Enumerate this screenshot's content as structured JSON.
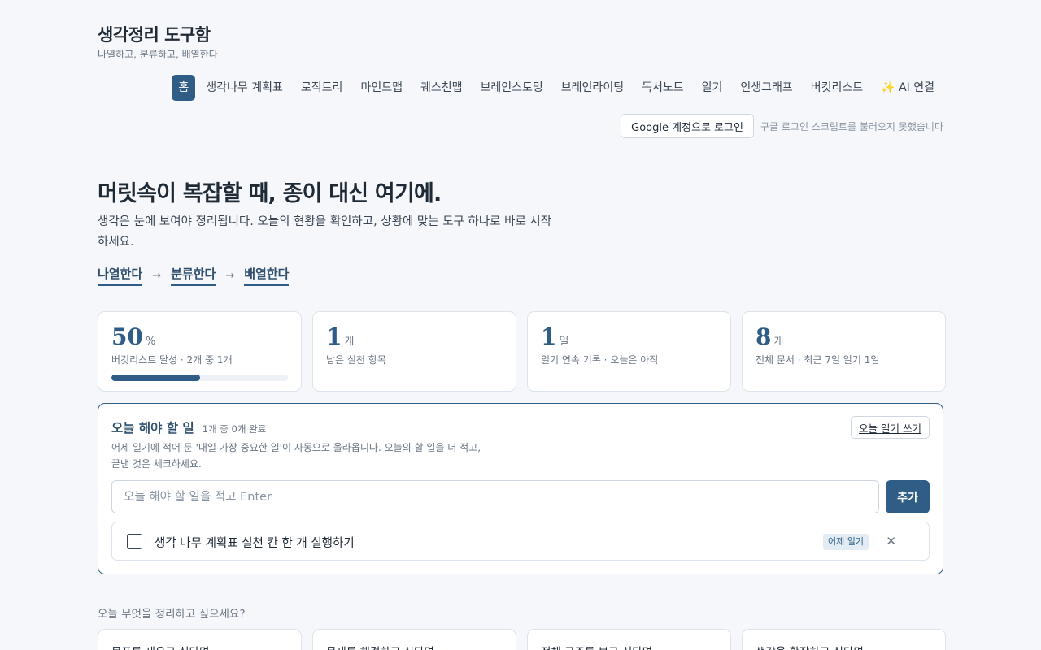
{
  "brand": {
    "title": "생각정리 도구함",
    "subtitle": "나열하고, 분류하고, 배열한다"
  },
  "nav": [
    {
      "label": "홈",
      "active": true
    },
    {
      "label": "생각나무 계획표"
    },
    {
      "label": "로직트리"
    },
    {
      "label": "마인드맵"
    },
    {
      "label": "퀘스천맵"
    },
    {
      "label": "브레인스토밍"
    },
    {
      "label": "브레인라이팅"
    },
    {
      "label": "독서노트"
    },
    {
      "label": "일기"
    },
    {
      "label": "인생그래프"
    },
    {
      "label": "버킷리스트"
    },
    {
      "label": "✨ AI 연결"
    }
  ],
  "login": {
    "button": "Google 계정으로 로그인",
    "note": "구글 로그인 스크립트를 불러오지 못했습니다"
  },
  "hero": {
    "title": "머릿속이 복잡할 때, 종이 대신 여기에.",
    "desc": "생각은 눈에 보여야 정리됩니다. 오늘의 현황을 확인하고, 상황에 맞는 도구 하나로 바로 시작하세요.",
    "steps": [
      "나열한다",
      "분류한다",
      "배열한다"
    ],
    "arrow": "→"
  },
  "stats": [
    {
      "value": "50",
      "unit": "%",
      "label": "버킷리스트 달성 · 2개 중 1개",
      "progress": 0.5
    },
    {
      "value": "1",
      "unit": "개",
      "label": "남은 실천 항목"
    },
    {
      "value": "1",
      "unit": "일",
      "label": "일기 연속 기록 · 오늘은 아직"
    },
    {
      "value": "8",
      "unit": "개",
      "label": "전체 문서 · 최근 7일 일기 1일"
    }
  ],
  "today": {
    "title": "오늘 해야 할 일",
    "count": "1개 중 0개 완료",
    "desc": "어제 일기에 적어 둔 '내일 가장 중요한 일'이 자동으로 올라옵니다. 오늘의 할 일을 더 적고, 끝낸 것은 체크하세요.",
    "diary_button": "오늘 일기 쓰기",
    "input_placeholder": "오늘 해야 할 일을 적고 Enter",
    "add_button": "추가",
    "items": [
      {
        "text": "생각 나무 계획표 실천 칸 한 개 실행하기",
        "badge": "어제 일기",
        "done": false,
        "remove": "✕"
      }
    ]
  },
  "prompt": "오늘 무엇을 정리하고 싶으세요?",
  "cards": [
    {
      "title": "목표를 세우고 싶다면"
    },
    {
      "title": "문제를 해결하고 싶다면"
    },
    {
      "title": "전체 구조를 보고 싶다면"
    },
    {
      "title": "생각을 확장하고 싶다면"
    }
  ]
}
